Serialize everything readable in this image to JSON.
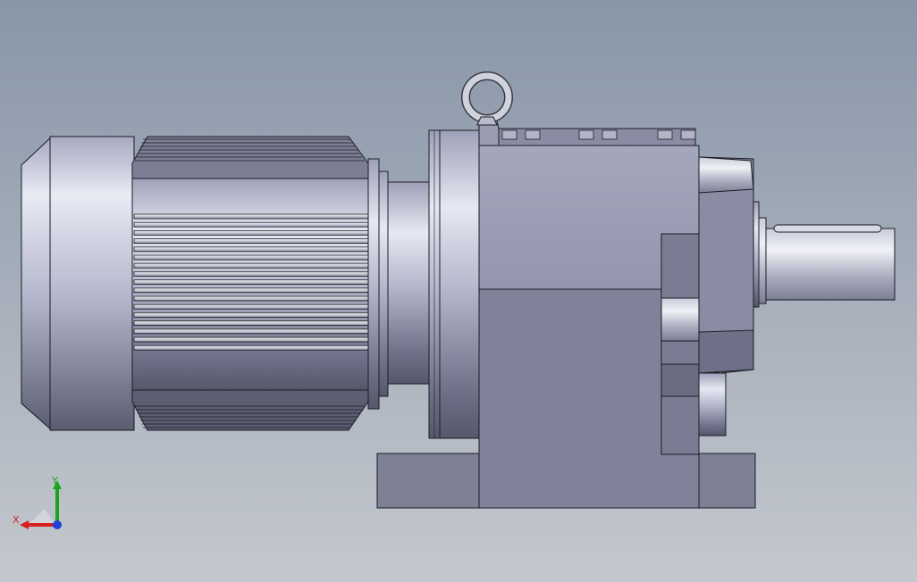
{
  "viewport": {
    "background_top": "#8896a8",
    "background_bottom": "#c4c8ce"
  },
  "model": {
    "description_icon": "gear-motor-3d-model"
  },
  "triad": {
    "x_label": "X",
    "y_label": "Y",
    "x_color": "#d42020",
    "y_color": "#1aa51a",
    "z_color": "#2040d8"
  }
}
